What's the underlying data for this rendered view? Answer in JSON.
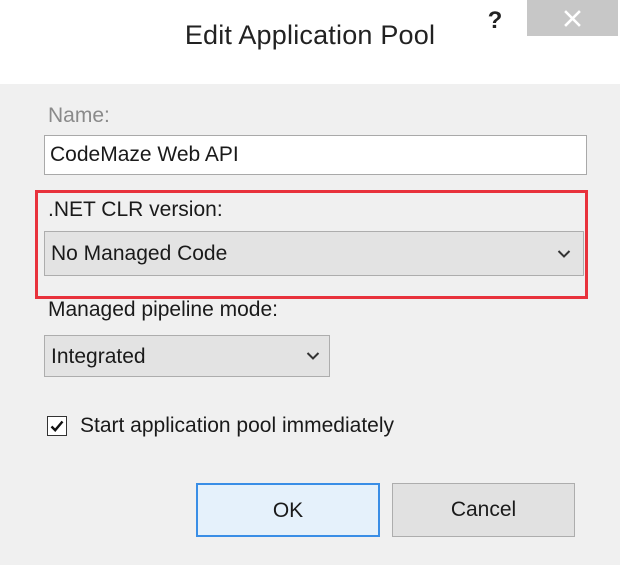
{
  "window": {
    "title": "Edit Application Pool",
    "help_label": "?"
  },
  "form": {
    "name_label": "Name:",
    "name_value": "CodeMaze Web API",
    "clr_label": ".NET CLR version:",
    "clr_value": "No Managed Code",
    "pipeline_label": "Managed pipeline mode:",
    "pipeline_value": "Integrated",
    "start_label": "Start application pool immediately",
    "start_checked": true
  },
  "buttons": {
    "ok_label": "OK",
    "cancel_label": "Cancel"
  },
  "colors": {
    "highlight": "#e8323c",
    "default_button_border": "#3a8ee6"
  }
}
